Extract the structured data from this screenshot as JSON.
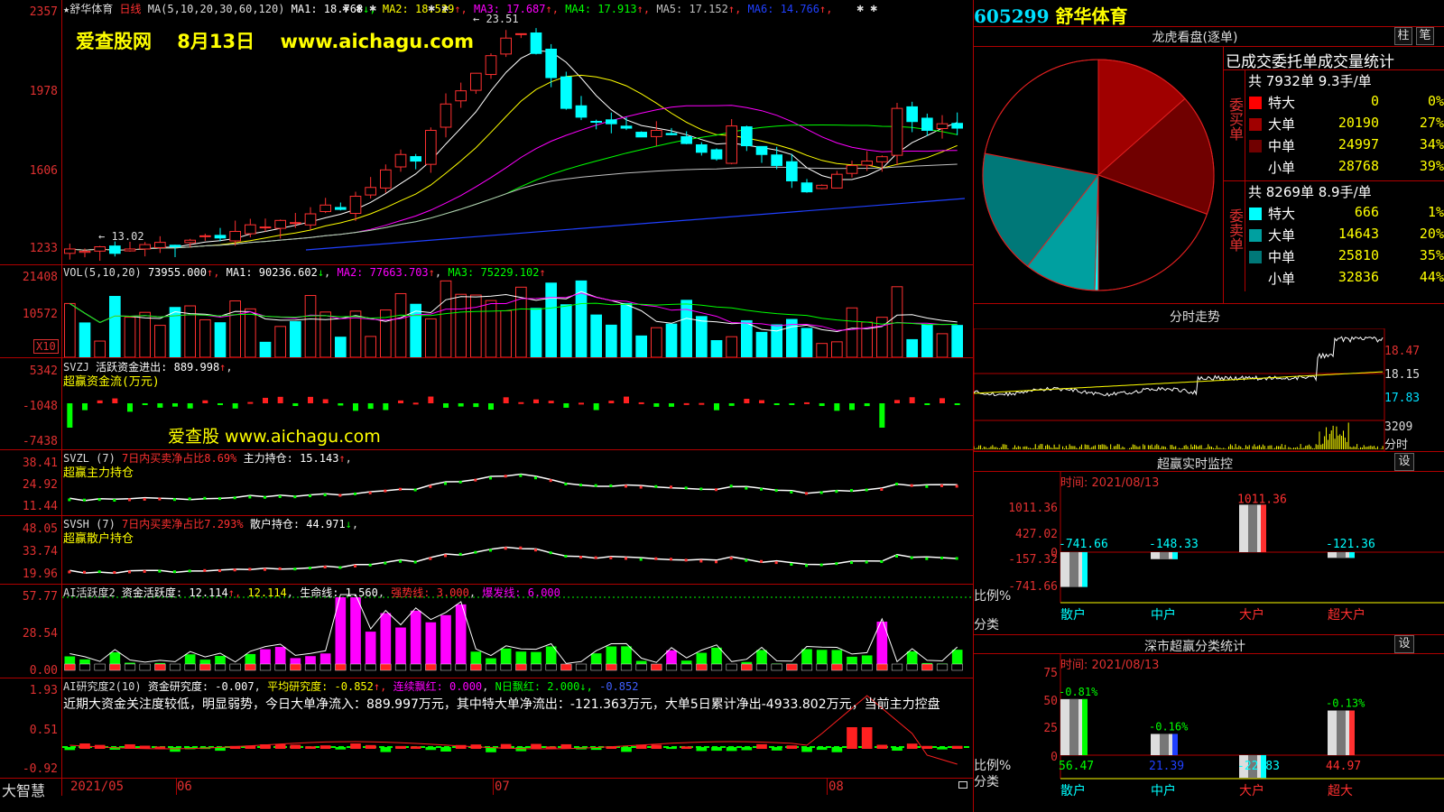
{
  "stock": {
    "code": "605299",
    "name": "舒华体育"
  },
  "main_chart": {
    "title": "★舒华体育",
    "period": "日线",
    "ma_prefix": "MA(5,10,20,30,60,120)",
    "ma": [
      {
        "label": "MA1: 18.768",
        "arrow": "↓",
        "color": "#ffffff"
      },
      {
        "label": "MA2: 18.529",
        "arrow": "↑",
        "color": "#ffff00"
      },
      {
        "label": "MA3: 17.687",
        "arrow": "↑",
        "color": "#ff00ff"
      },
      {
        "label": "MA4: 17.913",
        "arrow": "↑",
        "color": "#00ff00"
      },
      {
        "label": "MA5: 17.152",
        "arrow": "↑",
        "color": "#c0c0c0"
      },
      {
        "label": "MA6: 14.766",
        "arrow": "↑",
        "color": "#2040ff"
      }
    ],
    "y_labels": [
      "2357",
      "1978",
      "1606",
      "1233"
    ],
    "high_mark": "23.51",
    "low_mark": "13.02",
    "watermark": "爱查股网　 8月13日　 www.aichagu.com"
  },
  "vol_panel": {
    "title": "VOL(5,10,20)",
    "value": "73955.000",
    "ma1": "MA1: 90236.602",
    "ma1_arrow": "↓",
    "ma2": "MA2: 77663.703",
    "ma2_arrow": "↑",
    "ma3": "MA3: 75229.102",
    "ma3_arrow": "↑",
    "y_labels": [
      "21408",
      "10572"
    ],
    "unit": "X10"
  },
  "svzj_panel": {
    "title": "SVZJ",
    "line1": "活跃资金进出: 889.998",
    "arrow": "↑",
    "line2": "超赢资金流(万元)",
    "y_labels": [
      "5342",
      "-1048",
      "-7438"
    ],
    "watermark": "爱查股 www.aichagu.com"
  },
  "svzl_panel": {
    "title": "SVZL (7)",
    "ratio": "7日内买卖净占比8.69%",
    "hold": "主力持仓: 15.143",
    "arrow": "↑",
    "sub": "超赢主力持仓",
    "y_labels": [
      "38.41",
      "24.92",
      "11.44"
    ]
  },
  "svsh_panel": {
    "title": "SVSH (7)",
    "ratio": "7日内买卖净占比7.293%",
    "hold": "散户持仓: 44.971",
    "arrow": "↓",
    "sub": "超赢散户持仓",
    "y_labels": [
      "48.05",
      "33.74",
      "19.96"
    ]
  },
  "ai_active": {
    "title": "AI活跃度2",
    "activity": "资金活跃度: 12.114",
    "value2": "12.114",
    "life": "生命线: 1.560",
    "strong": "强势线: 3.000",
    "burst": "爆发线: 6.000",
    "y_labels": [
      "57.77",
      "28.54",
      "0.00"
    ]
  },
  "ai_research": {
    "title": "AI研究度2(10)",
    "research": "资金研究度: -0.007",
    "avg": "平均研究度: -0.852",
    "streak": "连续飘红: 0.000",
    "nday": "N日飘红: 2.000",
    "last": "-0.852",
    "summary": "近期大资金关注度较低，明显弱势，今日大单净流入：889.997万元，其中特大单净流出：-121.363万元，大单5日累计净出-4933.802万元，当前主力控盘",
    "y_labels": [
      "1.93",
      "0.51",
      "-0.92"
    ]
  },
  "x_axis": {
    "brand": "大智慧",
    "labels": [
      "2021/05",
      "06",
      "07",
      "08"
    ]
  },
  "right": {
    "lhb_title": "龙虎看盘(逐单)",
    "tab1": "柱",
    "tab2": "笔",
    "table_title": "已成交委托单成交量统计",
    "buy": {
      "side_label": "委买单",
      "summary": "共 7932单 9.3手/单",
      "rows": [
        {
          "label": "特大",
          "value": "0",
          "pct": "0%",
          "color": "#ff0000"
        },
        {
          "label": "大单",
          "value": "20190",
          "pct": "27%",
          "color": "#a00000"
        },
        {
          "label": "中单",
          "value": "24997",
          "pct": "34%",
          "color": "#700000"
        },
        {
          "label": "小单",
          "value": "28768",
          "pct": "39%",
          "color": "#000000"
        }
      ]
    },
    "sell": {
      "side_label": "委卖单",
      "summary": "共 8269单 8.9手/单",
      "rows": [
        {
          "label": "特大",
          "value": "666",
          "pct": "1%",
          "color": "#00ffff"
        },
        {
          "label": "大单",
          "value": "14643",
          "pct": "20%",
          "color": "#00a0a0"
        },
        {
          "label": "中单",
          "value": "25810",
          "pct": "35%",
          "color": "#007878"
        },
        {
          "label": "小单",
          "value": "32836",
          "pct": "44%",
          "color": "#000000"
        }
      ]
    },
    "intraday": {
      "title": "分时走势",
      "y_labels": [
        "18.47",
        "18.15",
        "17.83"
      ],
      "vol_label": "3209",
      "vol_unit": "分时"
    },
    "monitor": {
      "title": "超赢实时监控",
      "btn": "设",
      "time": "时间: 2021/08/13",
      "y_labels": [
        "1011.36",
        "427.02",
        "0",
        "-157.32",
        "-741.66"
      ],
      "left_labels": [
        "比例%",
        "分类"
      ],
      "chart_data": {
        "type": "bar",
        "categories": [
          "散户",
          "中户",
          "大户",
          "超大户"
        ],
        "values": [
          -741.66,
          -148.33,
          1011.36,
          -121.36
        ],
        "value_labels": [
          "-741.66",
          "-148.33",
          "1011.36",
          "-121.36"
        ]
      }
    },
    "sz_stats": {
      "title": "深市超赢分类统计",
      "btn": "设",
      "time": "时间: 2021/08/13",
      "y_labels": [
        "75",
        "50",
        "25",
        "0"
      ],
      "left_labels": [
        "比例%",
        "分类"
      ],
      "chart_data": {
        "type": "bar",
        "categories": [
          "散户",
          "中户",
          "大户",
          "超大"
        ],
        "values": [
          56.47,
          21.39,
          -22.83,
          44.97
        ],
        "changes": [
          "-0.81%",
          "-0.16%",
          "",
          "-0.13%"
        ],
        "value_labels": [
          "56.47",
          "21.39",
          "-22.83",
          "44.97"
        ]
      }
    }
  }
}
